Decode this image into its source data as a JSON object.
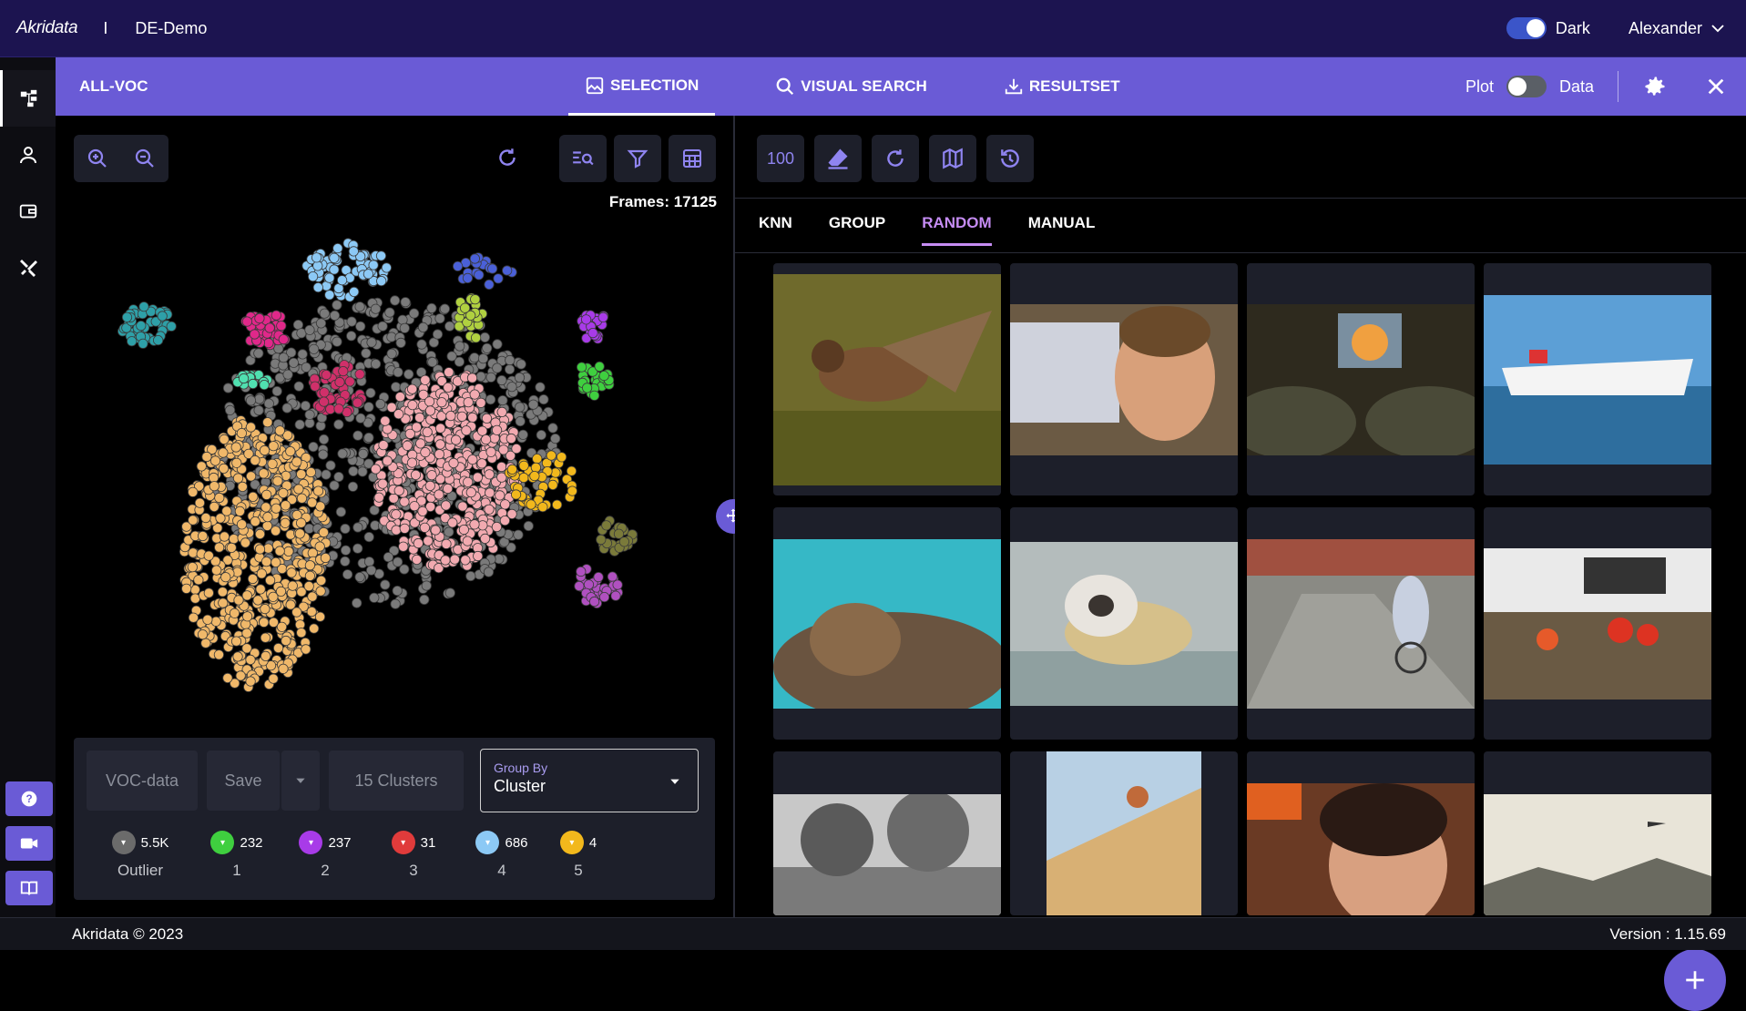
{
  "app": {
    "logo": "Akridata",
    "separator": "I",
    "project": "DE-Demo",
    "theme_label": "Dark",
    "theme_on": true,
    "user": "Alexander"
  },
  "subnav": {
    "dataset": "ALL-VOC",
    "tabs": [
      {
        "label": "SELECTION",
        "icon": "image-icon"
      },
      {
        "label": "VISUAL SEARCH",
        "icon": "search-icon"
      },
      {
        "label": "RESULTSET",
        "icon": "download-icon"
      }
    ],
    "plot_label": "Plot",
    "data_label": "Data"
  },
  "left": {
    "frames": "Frames: 17125",
    "dataset_chip": "VOC-data",
    "save_label": "Save",
    "clusters_label": "15 Clusters",
    "group_by_label": "Group By",
    "group_by_value": "Cluster",
    "legend": [
      {
        "count": "5.5K",
        "name": "Outlier",
        "color": "#6b6b6b"
      },
      {
        "count": "232",
        "name": "1",
        "color": "#3fcf3f"
      },
      {
        "count": "237",
        "name": "2",
        "color": "#a83be8"
      },
      {
        "count": "31",
        "name": "3",
        "color": "#e03b3b"
      },
      {
        "count": "686",
        "name": "4",
        "color": "#8cc9f5"
      },
      {
        "count": "4",
        "name": "5",
        "color": "#f2b81c"
      }
    ]
  },
  "right": {
    "count_button": "100",
    "tabs": [
      "KNN",
      "GROUP",
      "RANDOM",
      "MANUAL"
    ],
    "active_tab": "RANDOM"
  },
  "footer": {
    "copyright": "Akridata © 2023",
    "version": "Version : 1.15.69"
  }
}
